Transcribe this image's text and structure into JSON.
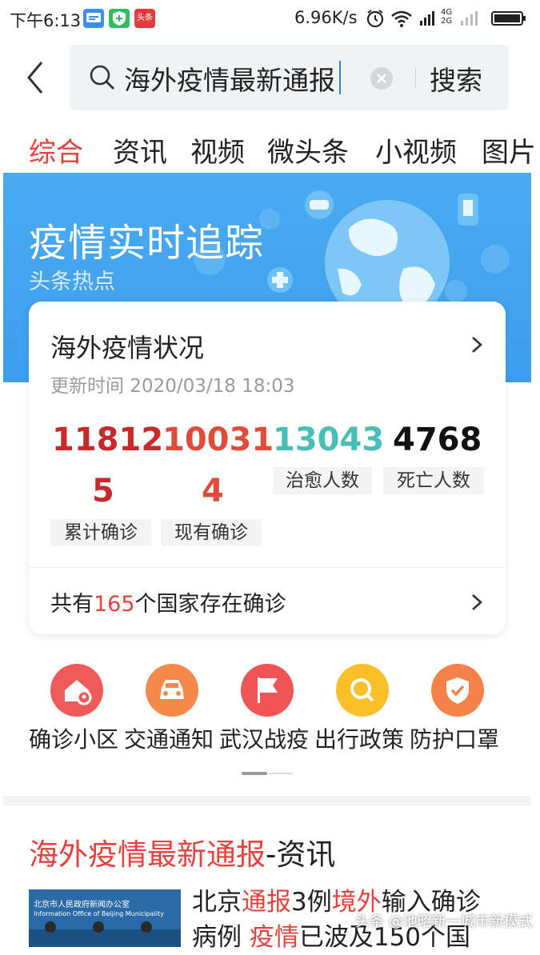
{
  "status_bar": {
    "time": "下午6:13",
    "speed": "6.96K/s",
    "app_badge": "头条",
    "network_small": "4G",
    "network_small2": "2G"
  },
  "search": {
    "query": "海外疫情最新通报",
    "button": "搜索"
  },
  "tabs": [
    "综合",
    "资讯",
    "视频",
    "微头条",
    "小视频",
    "图片"
  ],
  "banner": {
    "title": "疫情实时追踪",
    "subtitle": "头条热点"
  },
  "card": {
    "title": "海外疫情状况",
    "update": "更新时间 2020/03/18 18:03",
    "stats": [
      {
        "line1": "11812",
        "line2": "5",
        "label": "累计确诊",
        "color": "#c8292b"
      },
      {
        "line1": "10031",
        "line2": "4",
        "label": "现有确诊",
        "color": "#e24a3a"
      },
      {
        "line1": "13043",
        "line2": "",
        "label": "治愈人数",
        "color": "#47bfb6"
      },
      {
        "line1": "4768",
        "line2": "",
        "label": "死亡人数",
        "color": "#111111"
      }
    ],
    "countries_prefix": "共有",
    "countries_count": "165",
    "countries_suffix": "个国家存在确诊"
  },
  "quick_links": [
    {
      "label": "确诊小区",
      "icon": "home-location-icon",
      "color": "#f25a5a"
    },
    {
      "label": "交通通知",
      "icon": "car-icon",
      "color": "#f6894a"
    },
    {
      "label": "武汉战疫",
      "icon": "flag-icon",
      "color": "#f05454"
    },
    {
      "label": "出行政策",
      "icon": "search-icon",
      "color": "#fbbf2a"
    },
    {
      "label": "防护口罩",
      "icon": "shield-icon",
      "color": "#f6824a"
    }
  ],
  "news": {
    "title_highlight": "海外疫情最新通报",
    "title_suffix": "-资讯",
    "thumb_line1": "北京市人民政府新闻办公室",
    "thumb_line2": "Information Office of Beijing Municipality",
    "text_1": "北京",
    "text_2": "通报",
    "text_3": "3例",
    "text_4": "境外",
    "text_5": "输入确诊",
    "text_6": "病例 ",
    "text_7": "疫情",
    "text_8": "已波及150个国",
    "watermark": "头条 @池昭新一城市新模式"
  }
}
